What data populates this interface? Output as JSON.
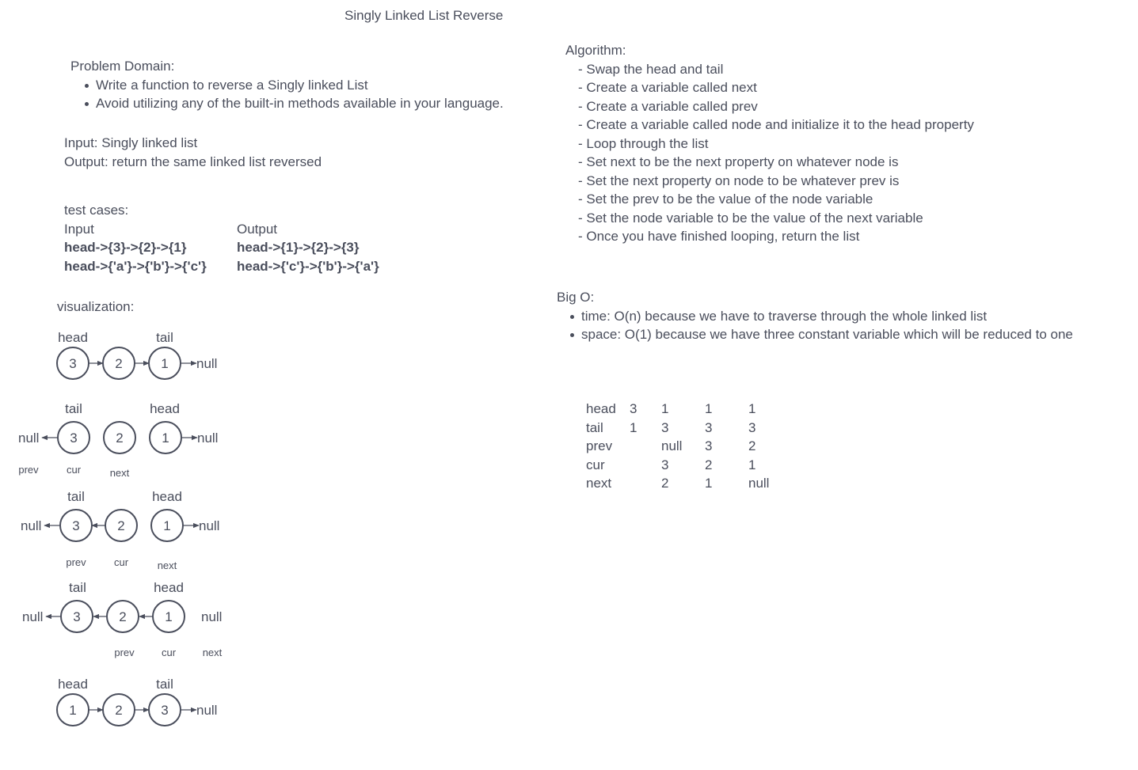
{
  "title": "Singly Linked List Reverse",
  "problem_domain": {
    "heading": "Problem Domain:",
    "items": [
      "Write a function to reverse a Singly linked List",
      "Avoid utilizing any of the built-in methods available in your language."
    ]
  },
  "io": {
    "input": "Input: Singly linked list",
    "output": "Output: return the same linked list reversed"
  },
  "tests": {
    "heading": "test cases:",
    "input_header": "Input",
    "output_header": "Output",
    "rows": [
      {
        "input": "head->{3}->{2}->{1}",
        "output": "head->{1}->{2}->{3}"
      },
      {
        "input": "head->{'a'}->{'b'}->{'c'}",
        "output": "head->{'c'}->{'b'}->{'a'}"
      }
    ]
  },
  "visualization_label": "visualization:",
  "algorithm": {
    "heading": "Algorithm:",
    "steps": [
      "- Swap the head and tail",
      "- Create a variable called next",
      "- Create a variable called prev",
      "- Create a variable called node and initialize it to the head property",
      "- Loop through the list",
      "- Set next to be the next property on whatever node is",
      "- Set the next property on node to be whatever prev is",
      "- Set the prev to be the value of the node variable",
      "- Set the node variable to be the value of the next variable",
      "- Once you have finished looping, return the list"
    ]
  },
  "big_o": {
    "heading": "Big O:",
    "items": [
      "time: O(n) because we have to traverse through the whole linked list",
      "space: O(1) because we have three constant variable which will be reduced to one"
    ]
  },
  "trace_table": {
    "rows": [
      [
        "head",
        "3",
        "1",
        "1",
        "1"
      ],
      [
        "tail",
        "1",
        "3",
        "3",
        "3"
      ],
      [
        "prev",
        "",
        "null",
        "3",
        "2"
      ],
      [
        "cur",
        "",
        "3",
        "2",
        "1"
      ],
      [
        "next",
        "",
        "2",
        "1",
        "null"
      ]
    ]
  },
  "diagram": {
    "null_text": "null",
    "rows": [
      {
        "labels_top": [
          "head",
          "tail"
        ],
        "nodes": [
          "3",
          "2",
          "1"
        ]
      },
      {
        "labels_top": [
          "tail",
          "head"
        ],
        "nodes": [
          "3",
          "2",
          "1"
        ],
        "labels_bottom": [
          "prev",
          "cur",
          "next"
        ]
      },
      {
        "labels_top": [
          "tail",
          "head"
        ],
        "nodes": [
          "3",
          "2",
          "1"
        ],
        "labels_bottom": [
          "prev",
          "cur",
          "next"
        ]
      },
      {
        "labels_top": [
          "tail",
          "head"
        ],
        "nodes": [
          "3",
          "2",
          "1"
        ],
        "labels_bottom": [
          "prev",
          "cur",
          "next"
        ]
      },
      {
        "labels_top": [
          "head",
          "tail"
        ],
        "nodes": [
          "1",
          "2",
          "3"
        ]
      }
    ]
  }
}
